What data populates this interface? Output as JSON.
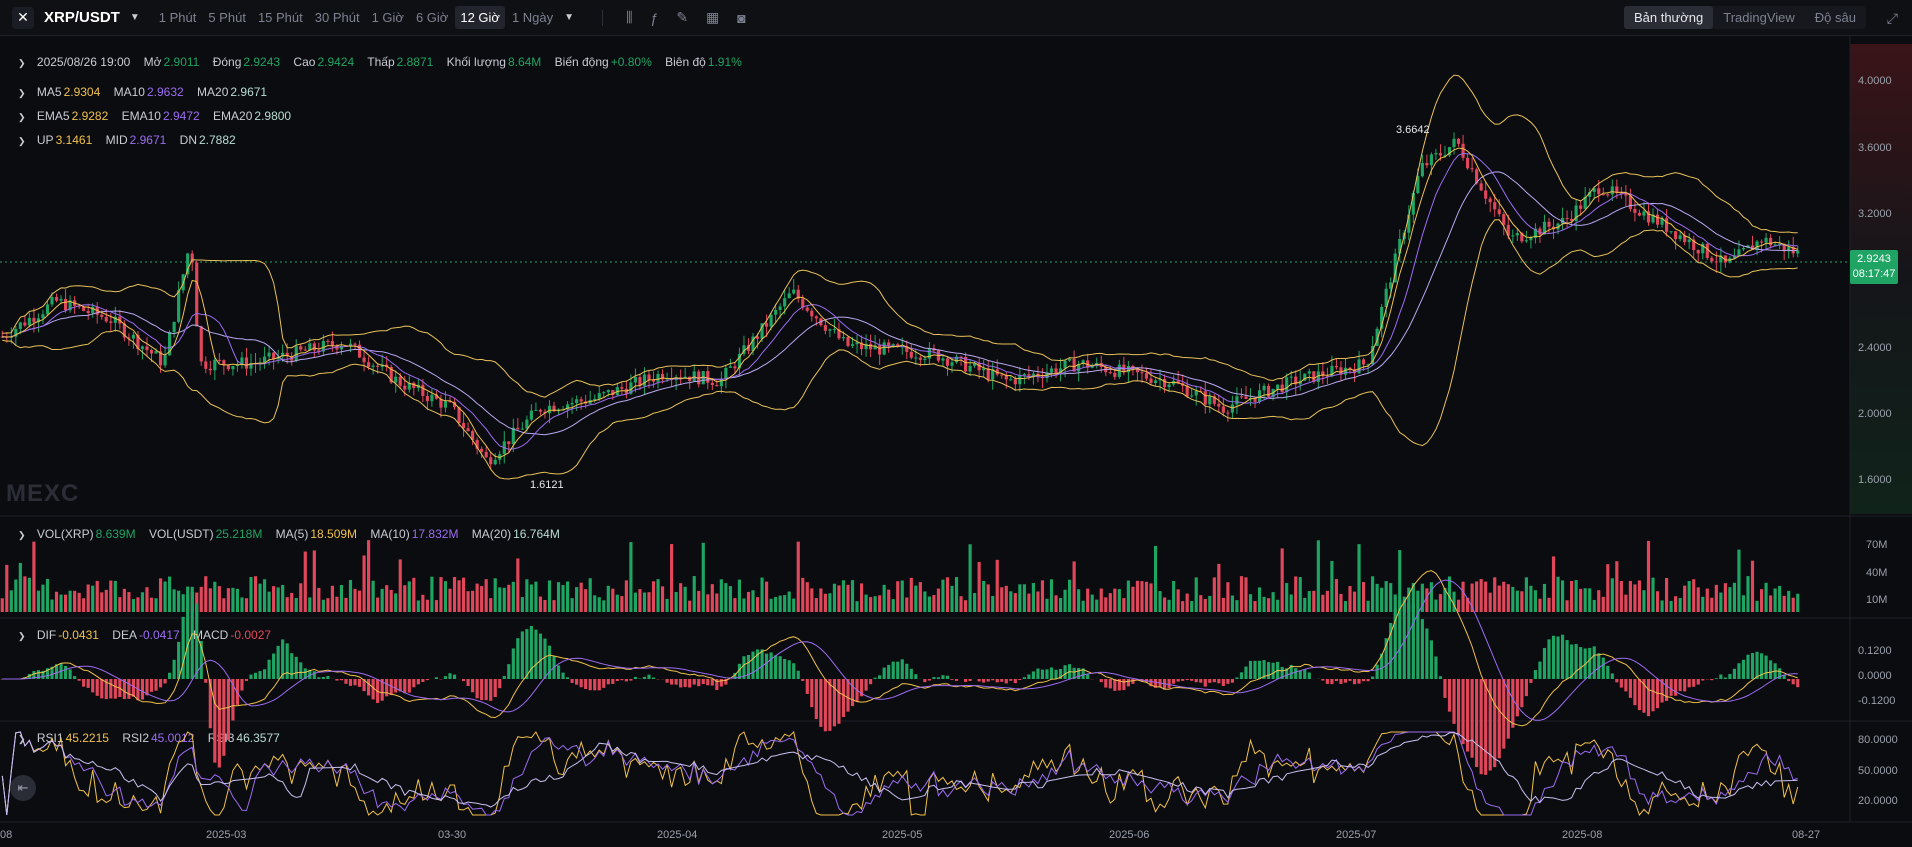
{
  "toolbar": {
    "symbol": "XRP/USDT",
    "timeframes": [
      "1 Phút",
      "5 Phút",
      "15 Phút",
      "30 Phút",
      "1 Giờ",
      "6 Giờ",
      "12 Giờ",
      "1 Ngày"
    ],
    "active_timeframe": "12 Giờ",
    "view_modes": [
      "Bản thường",
      "TradingView",
      "Độ sâu"
    ],
    "active_view": "Bản thường"
  },
  "ohlc": {
    "date": "2025/08/26 19:00",
    "open_label": "Mở",
    "open": "2.9011",
    "close_label": "Đóng",
    "close": "2.9243",
    "high_label": "Cao",
    "high": "2.9424",
    "low_label": "Thấp",
    "low": "2.8871",
    "volume_label": "Khối lượng",
    "volume": "8.64M",
    "change_label": "Biến động",
    "change": "+0.80%",
    "amplitude_label": "Biên độ",
    "amplitude": "1.91%"
  },
  "ma": {
    "ma5_label": "MA5",
    "ma5": "2.9304",
    "ma10_label": "MA10",
    "ma10": "2.9632",
    "ma20_label": "MA20",
    "ma20": "2.9671"
  },
  "ema": {
    "ema5_label": "EMA5",
    "ema5": "2.9282",
    "ema10_label": "EMA10",
    "ema10": "2.9472",
    "ema20_label": "EMA20",
    "ema20": "2.9800"
  },
  "boll": {
    "up_label": "UP",
    "up": "3.1461",
    "mid_label": "MID",
    "mid": "2.9671",
    "dn_label": "DN",
    "dn": "2.7882"
  },
  "price_axis": [
    "4.0000",
    "3.6000",
    "3.2000",
    "2.4000",
    "2.0000",
    "1.6000"
  ],
  "current_price": {
    "price": "2.9243",
    "countdown": "08:17:47"
  },
  "annotations": {
    "high": "3.6642",
    "low": "1.6121"
  },
  "watermark": "MEXC",
  "volume": {
    "vol_label": "VOL(XRP)",
    "vol": "8.639M",
    "volu_label": "VOL(USDT)",
    "volu": "25.218M",
    "ma5_label": "MA(5)",
    "ma5": "18.509M",
    "ma10_label": "MA(10)",
    "ma10": "17.832M",
    "ma20_label": "MA(20)",
    "ma20": "16.764M",
    "axis": [
      "70M",
      "40M",
      "10M"
    ]
  },
  "macd": {
    "dif_label": "DIF",
    "dif": "-0.0431",
    "dea_label": "DEA",
    "dea": "-0.0417",
    "macd_label": "MACD",
    "macd": "-0.0027",
    "axis": [
      "0.1200",
      "0.0000",
      "-0.1200"
    ]
  },
  "rsi": {
    "rsi1_label": "RSI1",
    "rsi1": "45.2215",
    "rsi2_label": "RSI2",
    "rsi2": "45.0012",
    "rsi3_label": "RSI3",
    "rsi3": "46.3577",
    "axis": [
      "80.0000",
      "50.0000",
      "20.0000"
    ]
  },
  "x_axis": [
    "08",
    "2025-03",
    "03-30",
    "2025-04",
    "2025-05",
    "2025-06",
    "2025-07",
    "2025-08",
    "08-27"
  ],
  "colors": {
    "up": "#1fa463",
    "down": "#e0475a",
    "ma5": "#f0c14b",
    "ma10": "#9b6cf0",
    "ma20": "#c9c0f0",
    "boll": "#e8c15a",
    "dif": "#f0c14b",
    "dea": "#9b6cf0"
  },
  "icons": [
    "xrp-logo-icon",
    "candle-type-icon",
    "indicator-fx-icon",
    "draw-pen-icon",
    "layout-grid-icon",
    "camera-icon",
    "fullscreen-icon",
    "scroll-to-latest-icon"
  ],
  "chart_data": {
    "type": "candlestick",
    "symbol": "XRP/USDT",
    "interval": "12 Giờ",
    "x": [
      "2025-02-08",
      "2025-03-01",
      "2025-03-30",
      "2025-04-01",
      "2025-05-01",
      "2025-06-01",
      "2025-07-01",
      "2025-08-01",
      "2025-08-27"
    ],
    "close": [
      2.45,
      2.25,
      2.05,
      2.05,
      2.15,
      2.2,
      2.25,
      3.05,
      2.92
    ],
    "ylim": [
      1.45,
      4.1
    ],
    "high": 3.6642,
    "low": 1.6121
  }
}
